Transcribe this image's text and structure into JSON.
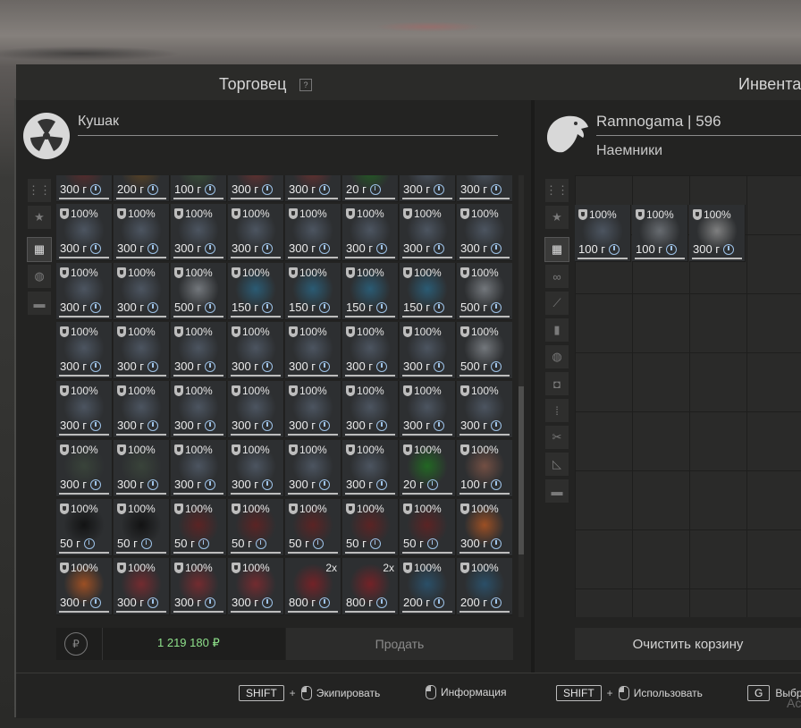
{
  "header": {
    "trader_title": "Торговец",
    "help": "?",
    "inventory_title": "Инвента"
  },
  "trader": {
    "name": "Кушак"
  },
  "player": {
    "name": "Ramnogama | 596",
    "faction": "Наемники"
  },
  "left_tabs": [
    "grid-lines-icon",
    "star-icon",
    "grid-icon",
    "ball-icon",
    "archive-icon"
  ],
  "right_tabs": [
    "grid-lines-icon",
    "star-icon",
    "grid-icon",
    "link-icon",
    "rifle-icon",
    "bullet-icon",
    "ball-icon",
    "camera-icon",
    "ammo-icon",
    "tools-icon",
    "ruler-icon",
    "archive-icon"
  ],
  "trader_grid": {
    "rows": [
      [
        {
          "p": "300 г",
          "c": "#6a2a2a"
        },
        {
          "p": "200 г",
          "c": "#6a4a20"
        },
        {
          "p": "100 г",
          "c": "#3a5a3a"
        },
        {
          "p": "300 г",
          "c": "#7a3030"
        },
        {
          "p": "300 г",
          "c": "#7a3030"
        },
        {
          "p": "20 г",
          "c": "#1f6a1f"
        },
        {
          "p": "300 г",
          "c": "#556070"
        },
        {
          "p": "300 г",
          "c": "#556070"
        }
      ],
      [
        {
          "d": "100%",
          "p": "300 г",
          "c": "#566170"
        },
        {
          "d": "100%",
          "p": "300 г",
          "c": "#566170"
        },
        {
          "d": "100%",
          "p": "300 г",
          "c": "#566170"
        },
        {
          "d": "100%",
          "p": "300 г",
          "c": "#566170"
        },
        {
          "d": "100%",
          "p": "300 г",
          "c": "#566170"
        },
        {
          "d": "100%",
          "p": "300 г",
          "c": "#566170"
        },
        {
          "d": "100%",
          "p": "300 г",
          "c": "#566170"
        },
        {
          "d": "100%",
          "p": "300 г",
          "c": "#566170"
        }
      ],
      [
        {
          "d": "100%",
          "p": "300 г",
          "c": "#566170"
        },
        {
          "d": "100%",
          "p": "300 г",
          "c": "#566170"
        },
        {
          "d": "100%",
          "p": "500 г",
          "c": "#8a8f95"
        },
        {
          "d": "100%",
          "p": "150 г",
          "c": "#2a6a8a"
        },
        {
          "d": "100%",
          "p": "150 г",
          "c": "#2a6a8a"
        },
        {
          "d": "100%",
          "p": "150 г",
          "c": "#2a6a8a"
        },
        {
          "d": "100%",
          "p": "150 г",
          "c": "#2a6a8a"
        },
        {
          "d": "100%",
          "p": "500 г",
          "c": "#8a8f95"
        }
      ],
      [
        {
          "d": "100%",
          "p": "300 г",
          "c": "#566170"
        },
        {
          "d": "100%",
          "p": "300 г",
          "c": "#566170"
        },
        {
          "d": "100%",
          "p": "300 г",
          "c": "#566170"
        },
        {
          "d": "100%",
          "p": "300 г",
          "c": "#566170"
        },
        {
          "d": "100%",
          "p": "300 г",
          "c": "#566170"
        },
        {
          "d": "100%",
          "p": "300 г",
          "c": "#566170"
        },
        {
          "d": "100%",
          "p": "300 г",
          "c": "#566170"
        },
        {
          "d": "100%",
          "p": "500 г",
          "c": "#8a8f95"
        }
      ],
      [
        {
          "d": "100%",
          "p": "300 г",
          "c": "#566170"
        },
        {
          "d": "100%",
          "p": "300 г",
          "c": "#566170"
        },
        {
          "d": "100%",
          "p": "300 г",
          "c": "#566170"
        },
        {
          "d": "100%",
          "p": "300 г",
          "c": "#566170"
        },
        {
          "d": "100%",
          "p": "300 г",
          "c": "#566170"
        },
        {
          "d": "100%",
          "p": "300 г",
          "c": "#566170"
        },
        {
          "d": "100%",
          "p": "300 г",
          "c": "#566170"
        },
        {
          "d": "100%",
          "p": "300 г",
          "c": "#566170"
        }
      ],
      [
        {
          "d": "100%",
          "p": "300 г",
          "c": "#3d4a3d"
        },
        {
          "d": "100%",
          "p": "300 г",
          "c": "#3d4a3d"
        },
        {
          "d": "100%",
          "p": "300 г",
          "c": "#566170"
        },
        {
          "d": "100%",
          "p": "300 г",
          "c": "#566170"
        },
        {
          "d": "100%",
          "p": "300 г",
          "c": "#566170"
        },
        {
          "d": "100%",
          "p": "300 г",
          "c": "#566170"
        },
        {
          "d": "100%",
          "p": "20 г",
          "c": "#1f7a1f"
        },
        {
          "d": "100%",
          "p": "100 г",
          "c": "#8a5a4a"
        }
      ],
      [
        {
          "d": "100%",
          "p": "50 г",
          "c": "#0a0a0a"
        },
        {
          "d": "100%",
          "p": "50 г",
          "c": "#0a0a0a"
        },
        {
          "d": "100%",
          "p": "50 г",
          "c": "#6a2020"
        },
        {
          "d": "100%",
          "p": "50 г",
          "c": "#6a2020"
        },
        {
          "d": "100%",
          "p": "50 г",
          "c": "#6a2020"
        },
        {
          "d": "100%",
          "p": "50 г",
          "c": "#6a2020"
        },
        {
          "d": "100%",
          "p": "50 г",
          "c": "#6a2020"
        },
        {
          "d": "100%",
          "p": "300 г",
          "c": "#c05a20"
        }
      ],
      [
        {
          "d": "100%",
          "p": "300 г",
          "c": "#c05a20"
        },
        {
          "d": "100%",
          "p": "300 г",
          "c": "#8a2a30"
        },
        {
          "d": "100%",
          "p": "300 г",
          "c": "#8a2a30"
        },
        {
          "d": "100%",
          "p": "300 г",
          "c": "#8a2a30"
        },
        {
          "s": "2x",
          "p": "800 г",
          "c": "#8a1e24"
        },
        {
          "s": "2x",
          "p": "800 г",
          "c": "#8a1e24"
        },
        {
          "d": "100%",
          "p": "200 г",
          "c": "#2a5a7a"
        },
        {
          "d": "100%",
          "p": "200 г",
          "c": "#2a5a7a"
        }
      ]
    ]
  },
  "basket": [
    {
      "d": "100%",
      "p": "100 г",
      "c": "#566170"
    },
    {
      "d": "100%",
      "p": "100 г",
      "c": "#7a7f85"
    },
    {
      "d": "100%",
      "p": "300 г",
      "c": "#9a9a9a"
    }
  ],
  "footer": {
    "money": "1 219 180 ₽",
    "sell_label": "Продать",
    "clear_label": "Очистить корзину",
    "hint_equip": "Экипировать",
    "hint_info": "Информация",
    "hint_use": "Использовать",
    "hint_drop": "Выбр",
    "key_shift": "SHIFT",
    "key_g": "G",
    "plus": "+"
  },
  "corner": "Ac",
  "colors": {
    "money": "#8ee08a",
    "clock": "#9ec3e8"
  }
}
